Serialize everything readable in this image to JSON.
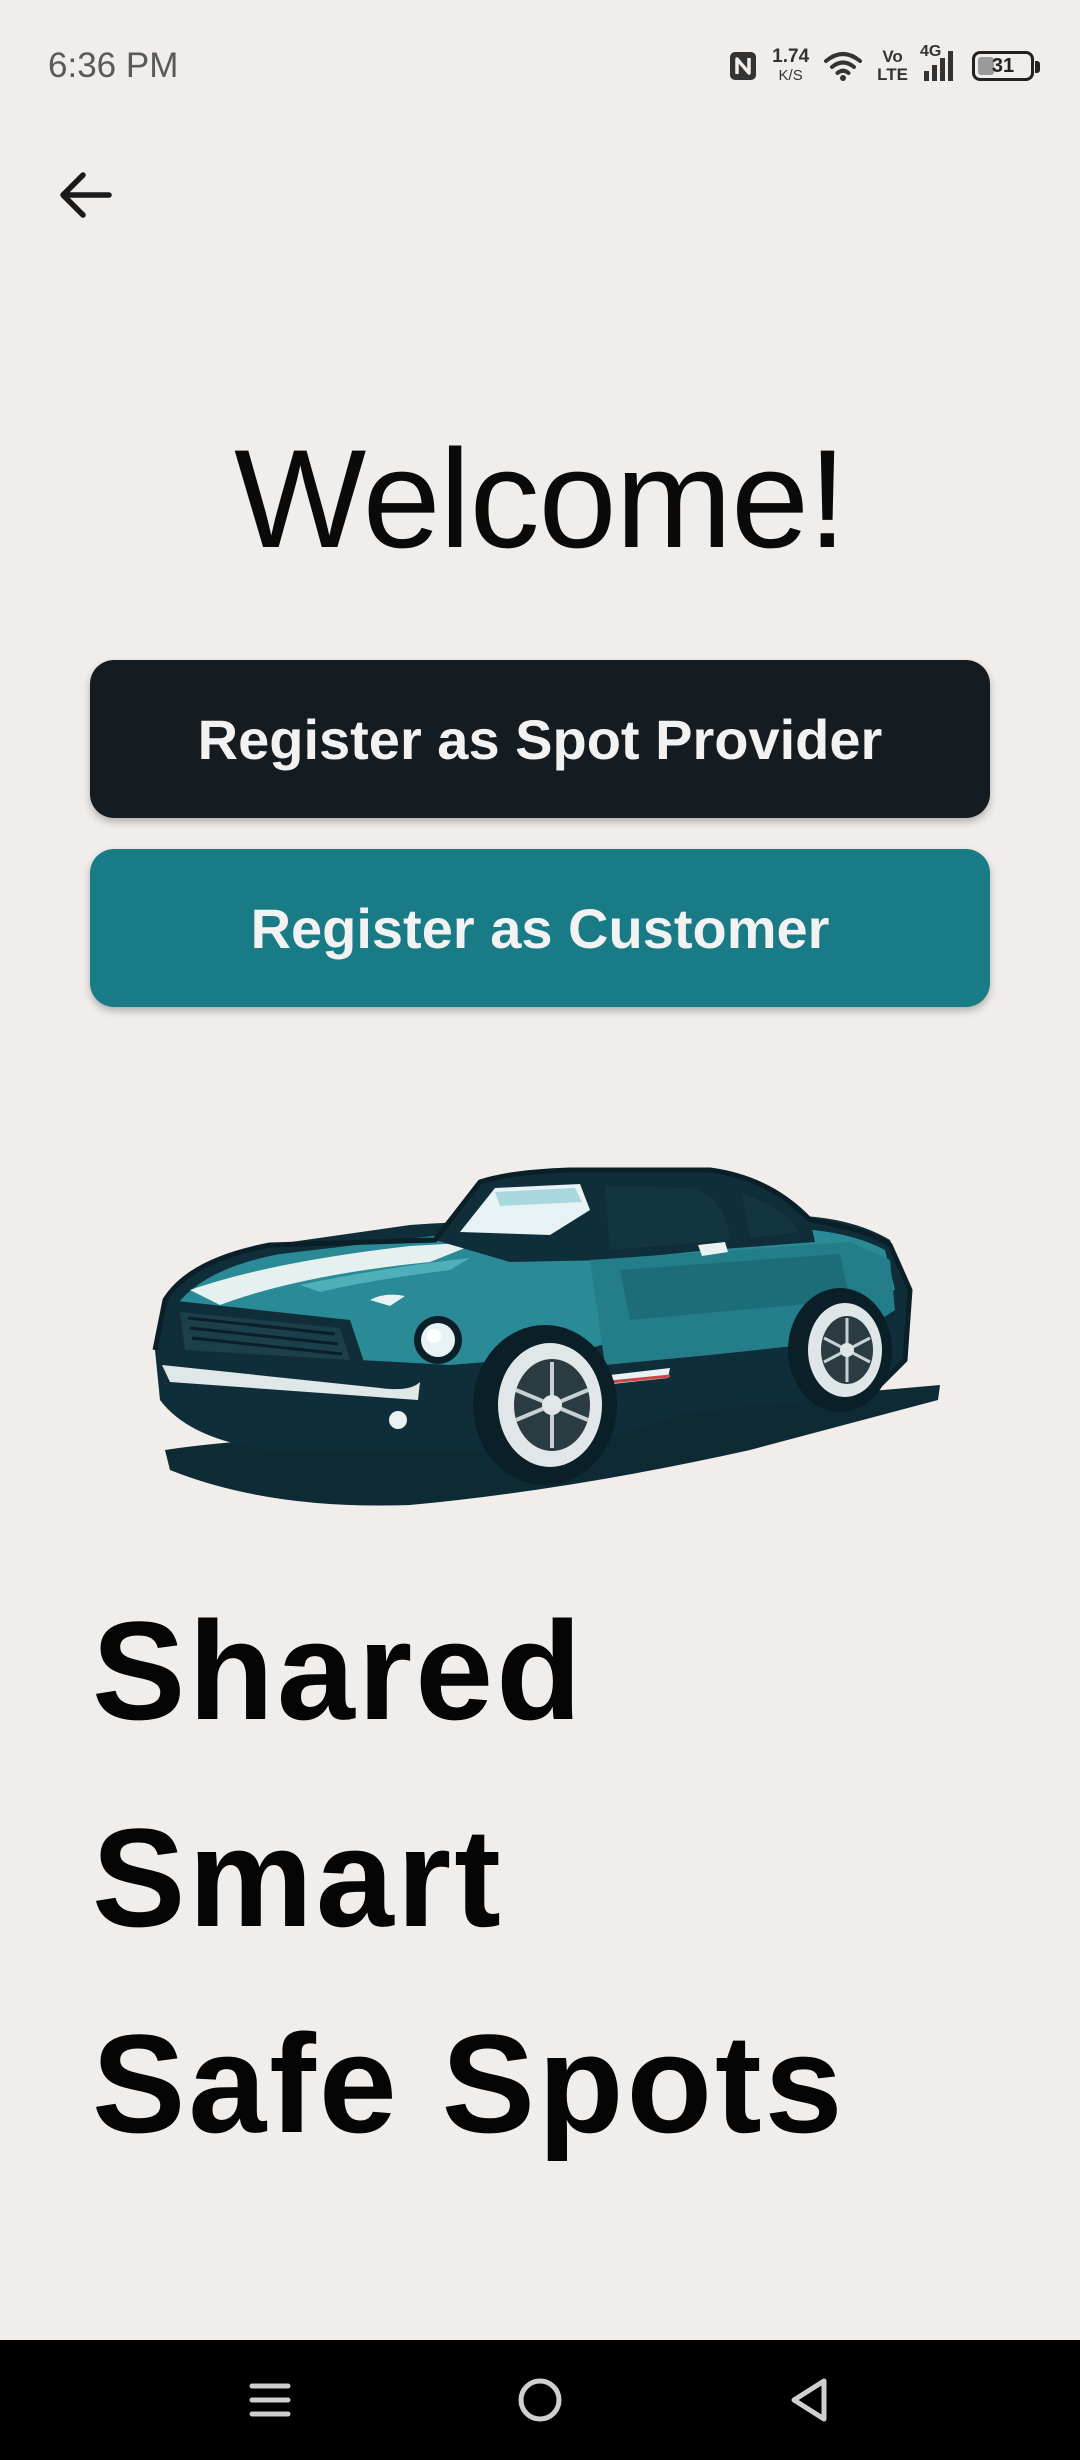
{
  "status_bar": {
    "time": "6:36 PM",
    "net_speed_value": "1.74",
    "net_speed_unit": "K/S",
    "volte_top": "Vo",
    "volte_bottom": "LTE",
    "network_type": "4G",
    "battery_level": "31",
    "battery_fraction": 0.31
  },
  "header": {
    "back_icon": "arrow-left-icon"
  },
  "main": {
    "title": "Welcome!",
    "register_provider_label": "Register as Spot Provider",
    "register_customer_label": "Register as Customer",
    "illustration": "sports-car-illustration",
    "tagline": [
      "Shared",
      "Smart",
      "Safe Spots"
    ]
  },
  "colors": {
    "background": "#f0edea",
    "provider_button": "#141b21",
    "customer_button": "#187b86",
    "car_teal": "#2a8a96"
  },
  "nav_bar": {
    "icons": [
      "menu-icon",
      "home-icon",
      "back-triangle-icon"
    ]
  }
}
